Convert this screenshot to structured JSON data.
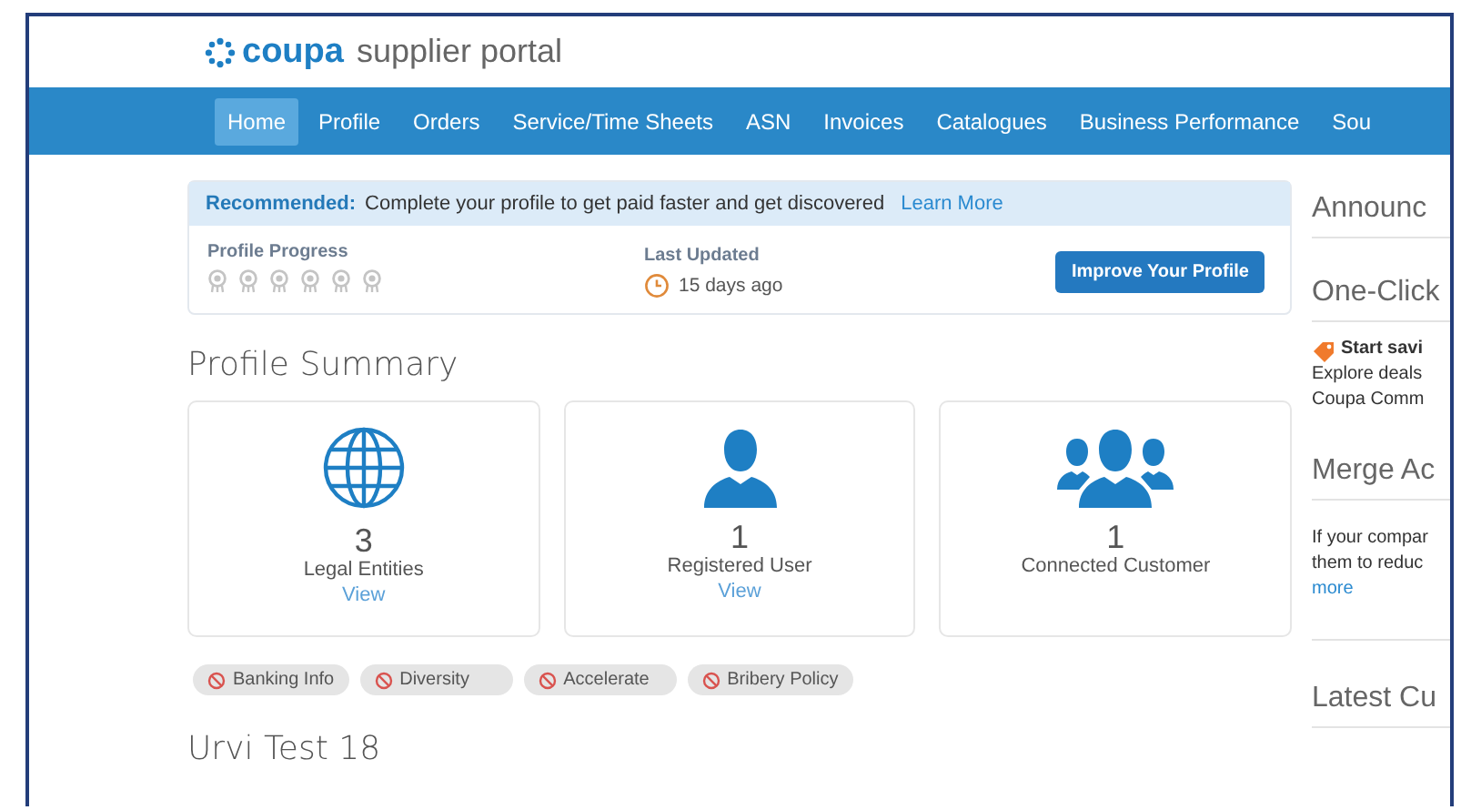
{
  "logo": {
    "brand": "coupa",
    "product": "supplier portal"
  },
  "nav": [
    {
      "label": "Home",
      "selected": true
    },
    {
      "label": "Profile",
      "selected": false
    },
    {
      "label": "Orders",
      "selected": false
    },
    {
      "label": "Service/Time Sheets",
      "selected": false
    },
    {
      "label": "ASN",
      "selected": false
    },
    {
      "label": "Invoices",
      "selected": false
    },
    {
      "label": "Catalogues",
      "selected": false
    },
    {
      "label": "Business Performance",
      "selected": false
    },
    {
      "label": "Sou",
      "selected": false
    }
  ],
  "recommendation": {
    "lead": "Recommended:",
    "text": "Complete your profile to get paid faster and get discovered",
    "link": "Learn More",
    "progress_label": "Profile Progress",
    "stars": 0,
    "updated_label": "Last Updated",
    "updated_value": "15 days ago",
    "button": "Improve Your Profile"
  },
  "summary_title": "Profile Summary",
  "cards": [
    {
      "kind": "globe",
      "count": "3",
      "label": "Legal Entities",
      "link": "View"
    },
    {
      "kind": "user",
      "count": "1",
      "label": "Registered User",
      "link": "View"
    },
    {
      "kind": "group",
      "count": "1",
      "label": "Connected Customer"
    }
  ],
  "chips": [
    "Banking Info",
    "Diversity",
    "Accelerate",
    "Bribery Policy"
  ],
  "customer_title": "Urvi Test 18",
  "side": [
    {
      "kind": "heading",
      "text": "Announc"
    },
    {
      "kind": "heading",
      "text": "One-Click"
    },
    {
      "kind": "promo",
      "title": "Start savi",
      "lines": [
        "Explore deals",
        "Coupa Comm"
      ]
    },
    {
      "kind": "heading",
      "text": "Merge Ac"
    },
    {
      "kind": "body",
      "lines": [
        "If your compar",
        "them to reduc"
      ],
      "link": "more"
    },
    {
      "kind": "heading",
      "text": "Latest Cu"
    }
  ]
}
